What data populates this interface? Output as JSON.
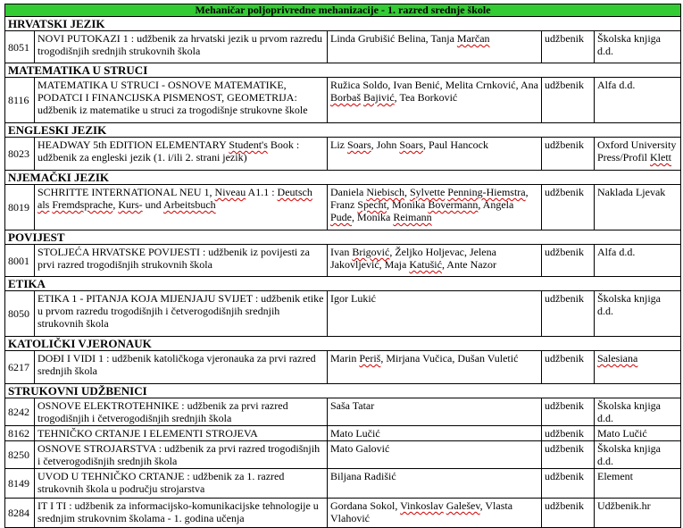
{
  "title": "Mehaničar poljoprivredne mehanizacije - 1. razred srednje škole",
  "sections": [
    {
      "name": "HRVATSKI JEZIK",
      "rows": [
        {
          "code": "8051",
          "title": "NOVI PUTOKAZI 1 : udžbenik za hrvatski jezik u prvom razredu trogodišnjih srednjih strukovnih škola",
          "authors": "Linda Grubišić Belina, Tanja Marčan",
          "type": "udžbenik",
          "publisher": "Školska knjiga d.d."
        }
      ]
    },
    {
      "name": "MATEMATIKA U STRUCI",
      "rows": [
        {
          "code": "8116",
          "title": "MATEMATIKA U STRUCI - OSNOVE MATEMATIKE, PODATCI I FINANCIJSKA PISMENOST, GEOMETRIJA: udžbenik iz matematike u struci za trogodišnje strukovne škole",
          "authors": "Ružica Soldo, Ivan Benić, Melita Crnković, Ana Borbaš Bajivić, Tea Borković",
          "type": "udžbenik",
          "publisher": "Alfa d.d."
        }
      ]
    },
    {
      "name": "ENGLESKI JEZIK",
      "rows": [
        {
          "code": "8023",
          "title": "HEADWAY 5th EDITION ELEMENTARY Student's Book : udžbenik za engleski jezik (1. i/ili 2. strani jezik)",
          "authors": "Liz Soars, John Soars, Paul Hancock",
          "type": "udžbenik",
          "publisher": "Oxford University Press/Profil Klett"
        }
      ]
    },
    {
      "name": "NJEMAČKI JEZIK",
      "rows": [
        {
          "code": "8019",
          "title": "SCHRITTE INTERNATIONAL NEU 1, Niveau A1.1 : Deutsch als Fremdsprache, Kurs- und Arbeitsbuch",
          "authors": "Daniela Niebisch, Sylvette Penning-Hiemstra, Franz Specht, Monika Bovermann, Angela Pude, Monika Reimann",
          "type": "udžbenik",
          "publisher": "Naklada Ljevak"
        }
      ]
    },
    {
      "name": "POVIJEST",
      "rows": [
        {
          "code": "8001",
          "title": "STOLJEĆA HRVATSKE POVIJESTI : udžbenik iz povijesti za prvi razred trogodišnjih strukovnih škola",
          "authors": "Ivan Brigović, Željko Holjevac, Jelena Jakovljević, Maja Katušić, Ante Nazor",
          "type": "udžbenik",
          "publisher": "Alfa d.d."
        }
      ]
    },
    {
      "name": "ETIKA",
      "rows": [
        {
          "code": "8050",
          "title": "ETIKA 1 - PITANJA KOJA MIJENJAJU SVIJET : udžbenik etike u prvom razredu trogodišnjih i četverogodišnjih srednjih strukovnih škola",
          "authors": "Igor Lukić",
          "type": "udžbenik",
          "publisher": "Školska knjiga d.d."
        }
      ]
    },
    {
      "name": "KATOLIČKI VJERONAUK",
      "rows": [
        {
          "code": "6217",
          "title": "DOĐI I VIDI 1 : udžbenik katoličkoga vjeronauka za prvi razred srednjih škola",
          "authors": "Marin Periš, Mirjana Vučica, Dušan Vuletić",
          "type": "udžbenik",
          "publisher": "Salesiana"
        }
      ]
    },
    {
      "name": "STRUKOVNI UDŽBENICI",
      "rows": [
        {
          "code": "8242",
          "title": "OSNOVE ELEKTROTEHNIKE : udžbenik za prvi razred trogodišnjih i četverogodišnjih srednjih škola",
          "authors": "Saša Tatar",
          "type": "udžbenik",
          "publisher": "Školska knjiga d.d."
        },
        {
          "code": "8162",
          "title": "TEHNIČKO CRTANJE I ELEMENTI STROJEVA",
          "authors": "Mato Lučić",
          "type": "udžbenik",
          "publisher": "Mato Lučić"
        },
        {
          "code": "8250",
          "title": "OSNOVE STROJARSTVA : udžbenik za prvi razred trogodišnjih i četverogodišnjih srednjih škola",
          "authors": "Mato Galović",
          "type": "udžbenik",
          "publisher": "Školska knjiga d.d."
        },
        {
          "code": "8149",
          "title": "UVOD U TEHNIČKO CRTANJE : udžbenik za 1. razred strukovnih škola u području strojarstva",
          "authors": "Biljana Radišić",
          "type": "udžbenik",
          "publisher": "Element"
        },
        {
          "code": "8284",
          "title": "IT I TI : udžbenik za informacijsko-komunikacijske tehnologije u srednjim strukovnim školama - 1. godina učenja",
          "authors": "Gordana Sokol, Vinkoslav Galešev, Vlasta Vlahović",
          "type": "udžbenik",
          "publisher": "Udžbenik.hr"
        }
      ]
    }
  ]
}
